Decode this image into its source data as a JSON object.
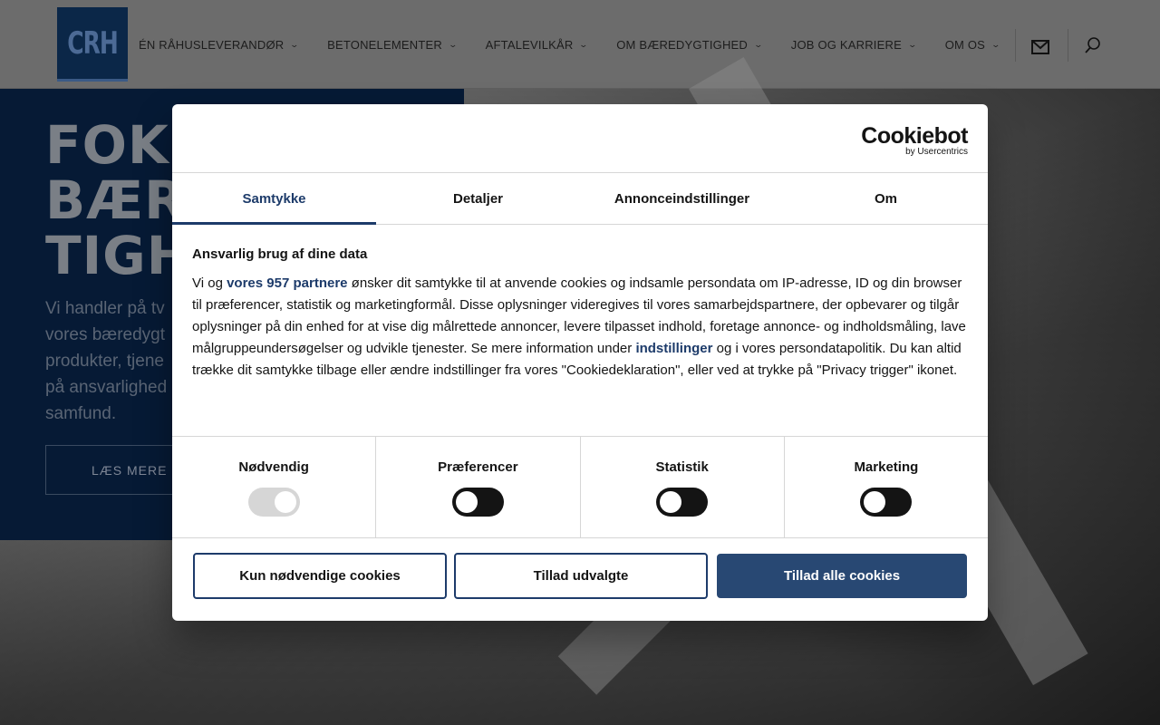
{
  "header": {
    "logo_text": "CRH",
    "nav": [
      {
        "label": "ÉN RÅHUSLEVERANDØR"
      },
      {
        "label": "BETONELEMENTER"
      },
      {
        "label": "AFTALEVILKÅR"
      },
      {
        "label": "OM BÆREDYGTIGHED"
      },
      {
        "label": "JOB OG KARRIERE"
      },
      {
        "label": "OM OS"
      }
    ],
    "icons": [
      "mail-icon",
      "search-icon"
    ]
  },
  "hero": {
    "title_lines": [
      "FOK",
      "BÆR",
      "TIGH"
    ],
    "text_lines": [
      "Vi handler på tv",
      "vores bæredygt",
      "produkter, tjene",
      "på ansvarlighed",
      "samfund."
    ],
    "button_label": "LÆS MERE"
  },
  "cookie_dialog": {
    "brand": "Cookiebot",
    "brand_sub": "by Usercentrics",
    "tabs": [
      {
        "label": "Samtykke",
        "active": true
      },
      {
        "label": "Detaljer",
        "active": false
      },
      {
        "label": "Annonceindstillinger",
        "active": false
      },
      {
        "label": "Om",
        "active": false
      }
    ],
    "heading": "Ansvarlig brug af dine data",
    "text_1": "Vi og ",
    "link_partners": "vores 957 partnere",
    "text_2": " ønsker dit samtykke til at anvende cookies og indsamle persondata om IP-adresse, ID og din browser til præferencer, statistik og marketingformål. Disse oplysninger videregives til vores samarbejdspartnere, der opbevarer og tilgår oplysninger på din enhed for at vise dig målrettede annoncer, levere tilpasset indhold, foretage annonce- og indholdsmåling, lave målgruppeundersøgelser og udvikle tjenester. Se mere information under ",
    "link_settings": "indstillinger",
    "text_3": " og i vores persondatapolitik. Du kan altid trække dit samtykke tilbage eller ændre indstillinger fra vores \"Cookiedeklaration\", eller ved at trykke på \"Privacy trigger\" ikonet.",
    "toggles": [
      {
        "label": "Nødvendig",
        "checked": true,
        "disabled": true
      },
      {
        "label": "Præferencer",
        "checked": false
      },
      {
        "label": "Statistik",
        "checked": false
      },
      {
        "label": "Marketing",
        "checked": false
      }
    ],
    "buttons": {
      "necessary_only": "Kun nødvendige cookies",
      "allow_selected": "Tillad udvalgte",
      "allow_all": "Tillad alle cookies"
    },
    "colors": {
      "accent": "#1d3b6a",
      "primary_button": "#284873"
    }
  }
}
